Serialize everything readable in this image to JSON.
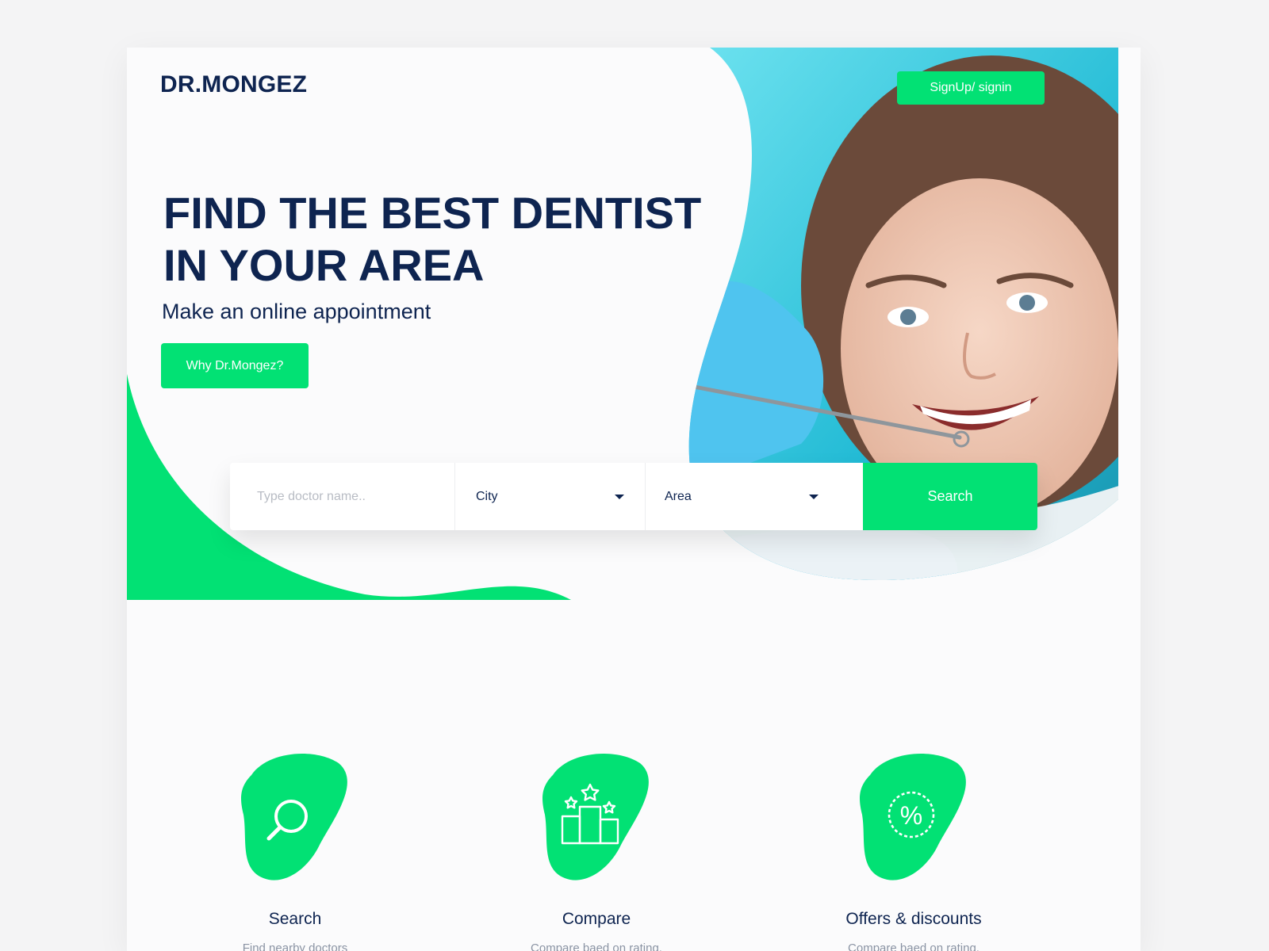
{
  "header": {
    "logo": "DR.MONGEZ",
    "signup_label": "SignUp/ signin"
  },
  "hero": {
    "headline": "FIND THE BEST DENTIST\nIN YOUR AREA",
    "subheadline": "Make an online appointment",
    "why_label": "Why Dr.Mongez?"
  },
  "search": {
    "name_placeholder": "Type doctor name..",
    "city_value": "City",
    "area_value": "Area",
    "search_label": "Search"
  },
  "features": [
    {
      "title": "Search",
      "description": "Find nearby doctors",
      "icon": "search-icon"
    },
    {
      "title": "Compare",
      "description": "Compare baed on rating.",
      "icon": "podium-stars-icon"
    },
    {
      "title": "Offers & discounts",
      "description": "Compare baed on rating.",
      "icon": "percent-icon"
    }
  ],
  "colors": {
    "accent": "#02e174",
    "navy": "#0e2450",
    "muted": "#8a93a3"
  }
}
